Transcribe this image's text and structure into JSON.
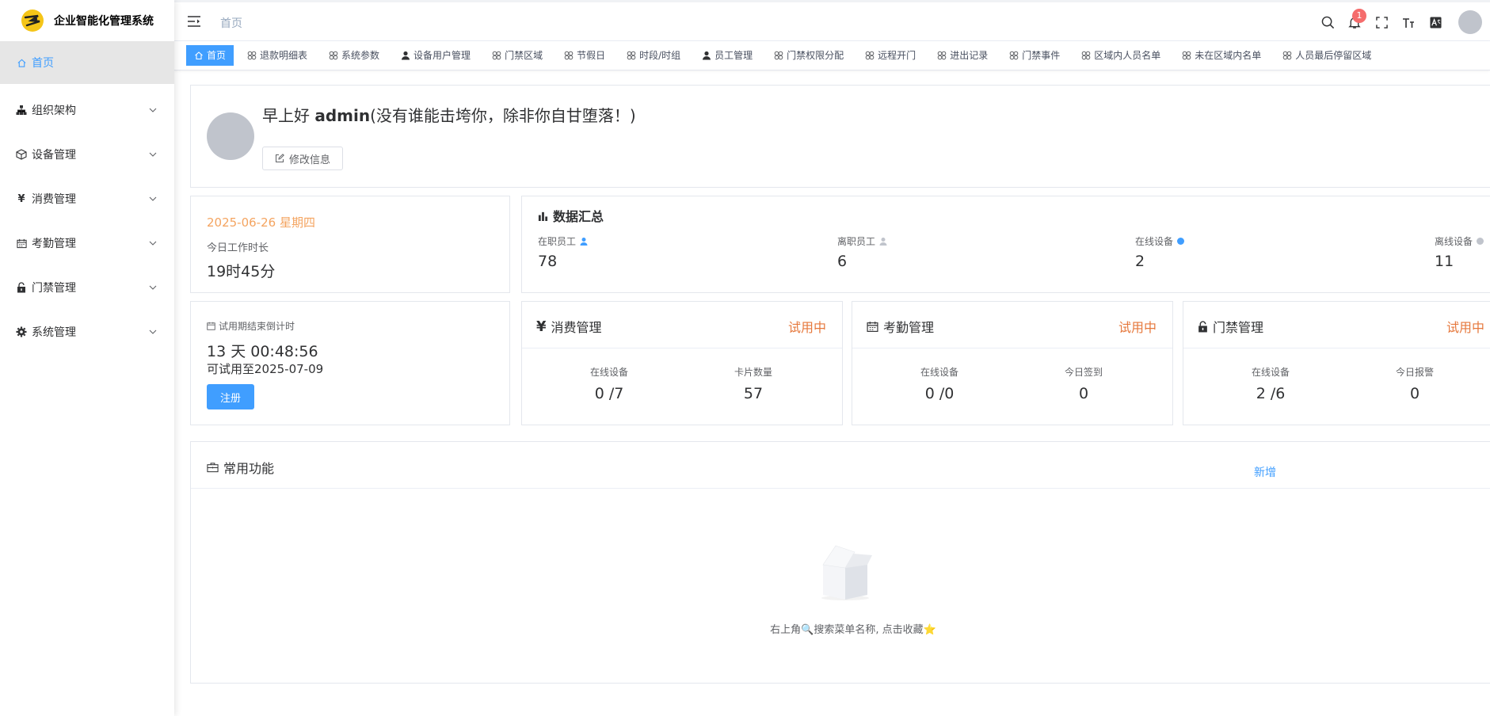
{
  "app": {
    "title": "企业智能化管理系统"
  },
  "sidebar": {
    "items": [
      {
        "label": "首页",
        "icon": "home-icon"
      },
      {
        "label": "组织架构",
        "icon": "org-icon"
      },
      {
        "label": "设备管理",
        "icon": "box-icon"
      },
      {
        "label": "消费管理",
        "icon": "yen-icon"
      },
      {
        "label": "考勤管理",
        "icon": "calendar-icon"
      },
      {
        "label": "门禁管理",
        "icon": "unlock-icon"
      },
      {
        "label": "系统管理",
        "icon": "gear-icon"
      }
    ]
  },
  "header": {
    "breadcrumb": "首页",
    "notification_count": "1"
  },
  "tags": [
    "首页",
    "退款明细表",
    "系统参数",
    "设备用户管理",
    "门禁区域",
    "节假日",
    "时段/时组",
    "员工管理",
    "门禁权限分配",
    "远程开门",
    "进出记录",
    "门禁事件",
    "区域内人员名单",
    "未在区域内名单",
    "人员最后停留区域"
  ],
  "welcome": {
    "greeting_prefix": "早上好 ",
    "username": "admin",
    "motto": "(没有谁能击垮你，除非你自甘堕落！)",
    "edit_label": "修改信息"
  },
  "today": {
    "date": "2025-06-26 星期四",
    "work_label": "今日工作时长",
    "work_value": "19时45分"
  },
  "summary": {
    "title": "数据汇总",
    "stats": [
      {
        "label": "在职员工",
        "value": "78"
      },
      {
        "label": "离职员工",
        "value": "6"
      },
      {
        "label": "在线设备",
        "value": "2"
      },
      {
        "label": "离线设备",
        "value": "11"
      }
    ],
    "colors": {
      "active": "#409eff",
      "inactive": "#c0c4cc"
    }
  },
  "trial": {
    "label": "试用期结束倒计时",
    "countdown": "13 天 00:48:56",
    "until": "可试用至2025-07-09",
    "register_label": "注册"
  },
  "modules": [
    {
      "title": "消费管理",
      "status": "试用中",
      "stat1_label": "在线设备",
      "stat1_value": "0 /7",
      "stat2_label": "卡片数量",
      "stat2_value": "57"
    },
    {
      "title": "考勤管理",
      "status": "试用中",
      "stat1_label": "在线设备",
      "stat1_value": "0 /0",
      "stat2_label": "今日签到",
      "stat2_value": "0"
    },
    {
      "title": "门禁管理",
      "status": "试用中",
      "stat1_label": "在线设备",
      "stat1_value": "2 /6",
      "stat2_label": "今日报警",
      "stat2_value": "0"
    }
  ],
  "common": {
    "title": "常用功能",
    "add_label": "新增",
    "empty_text": "右上角🔍搜索菜单名称, 点击收藏⭐"
  }
}
